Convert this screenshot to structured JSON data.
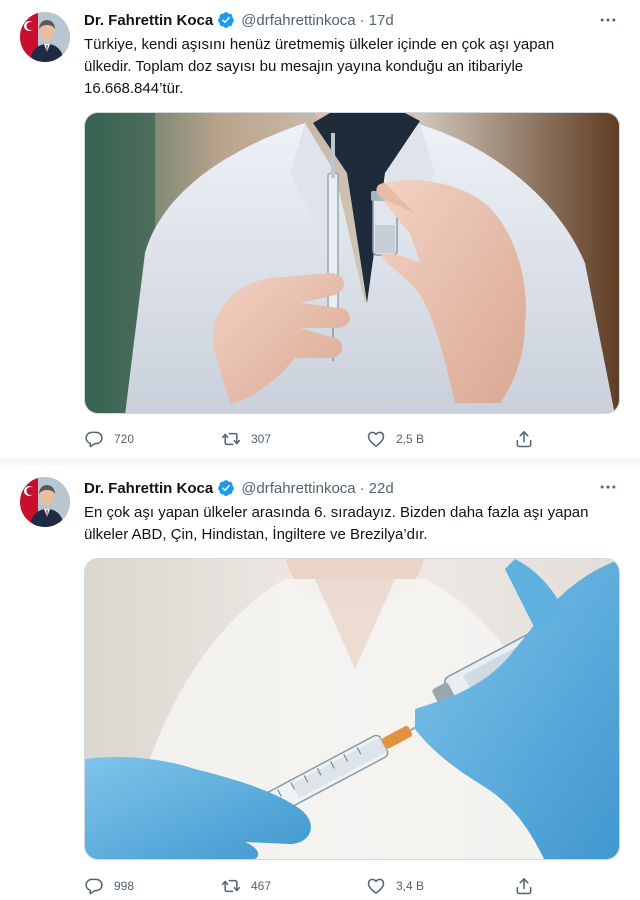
{
  "colors": {
    "accent": "#1d9bf0",
    "text": "#0f1419",
    "secondary": "#536471",
    "divider": "#f7f9f9"
  },
  "tweets": [
    {
      "name": "Dr. Fahrettin Koca",
      "handle": "@drfahrettinkoca",
      "separator": "·",
      "time": "17d",
      "text": "Türkiye, kendi aşısını henüz üretmemiş ülkeler içinde en çok aşı yapan ülkedir. Toplam doz sayısı bu mesajın yayına konduğu an itibariyle 16.668.844’tür.",
      "image": "photo-doctor-holding-syringe-and-vial",
      "replies": "720",
      "retweets": "307",
      "likes": "2,5 B",
      "icons": [
        "verified-icon",
        "more-icon",
        "reply-icon",
        "retweet-icon",
        "like-icon",
        "share-icon"
      ]
    },
    {
      "name": "Dr. Fahrettin Koca",
      "handle": "@drfahrettinkoca",
      "separator": "·",
      "time": "22d",
      "text": "En çok aşı yapan ülkeler arasında 6. sıradayız. Bizden daha fazla aşı yapan ülkeler ABD, Çin, Hindistan, İngiltere ve Brezilya’dır.",
      "image": "photo-gloved-hands-filling-syringe-from-vial",
      "replies": "998",
      "retweets": "467",
      "likes": "3,4 B",
      "icons": [
        "verified-icon",
        "more-icon",
        "reply-icon",
        "retweet-icon",
        "like-icon",
        "share-icon"
      ]
    }
  ]
}
